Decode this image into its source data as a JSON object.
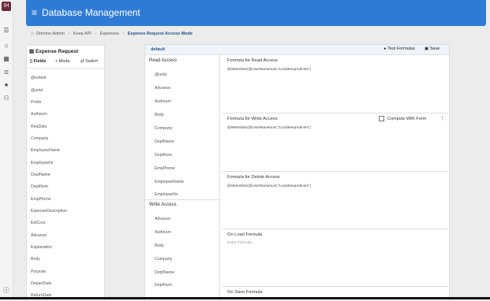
{
  "rail": {
    "logo": "IH",
    "icons": [
      "menu-icon",
      "home-icon",
      "table-icon",
      "list-icon",
      "user-icon",
      "group-icon",
      "info-icon"
    ]
  },
  "header": {
    "title": "Database Management"
  },
  "breadcrumb": {
    "items": [
      "Domino Admin",
      "Keep API",
      "Expenses",
      "Expense Request Access Mode"
    ]
  },
  "left_panel": {
    "title": "Expense Request",
    "tabs": [
      "Fields",
      "Mode",
      "Switch"
    ],
    "fields": [
      "@noteid",
      "@unid",
      "Prefix",
      "Authnum",
      "ReqDate",
      "Company",
      "EmployeeName",
      "EmployeeNr",
      "DeptName",
      "DeptNum",
      "EmpPhone",
      "ExpenseDescription",
      "EstCost",
      "Advance",
      "Explanation",
      "Body",
      "Purpose",
      "DepartDate",
      "ReturnDate"
    ]
  },
  "formula_panel": {
    "default_label": "default",
    "test_label": "Test Formulas",
    "save_label": "Save",
    "read_access": {
      "title": "Read Access",
      "items": [
        "@unid",
        "Advance",
        "Authnum",
        "Body",
        "Company",
        "DeptName",
        "DeptNum",
        "EmpPhone",
        "EmployeeName",
        "EmployeeNo"
      ]
    },
    "write_access": {
      "title": "Write Access",
      "items": [
        "Advance",
        "Authnum",
        "Body",
        "Company",
        "DeptName",
        "DeptNum"
      ]
    },
    "read_formula": {
      "label": "Formula for Read Access",
      "code": "@IsMember(@UserNamesList;\"LocalKeepAdmins\")"
    },
    "write_formula": {
      "label": "Formula for Write Access",
      "code": "@IsMember(@UserNamesList;\"LocalKeepAdmins\")",
      "compute_label": "Compute With Form"
    },
    "delete_formula": {
      "label": "Formula for Delete Access",
      "code": "@IsMember(@UserNamesList;\"LocalKeepAdmins\")"
    },
    "onload": {
      "label": "On Load Formula",
      "placeholder": "Enter Formula..."
    },
    "onsave": {
      "label": "On Save Formula"
    }
  }
}
